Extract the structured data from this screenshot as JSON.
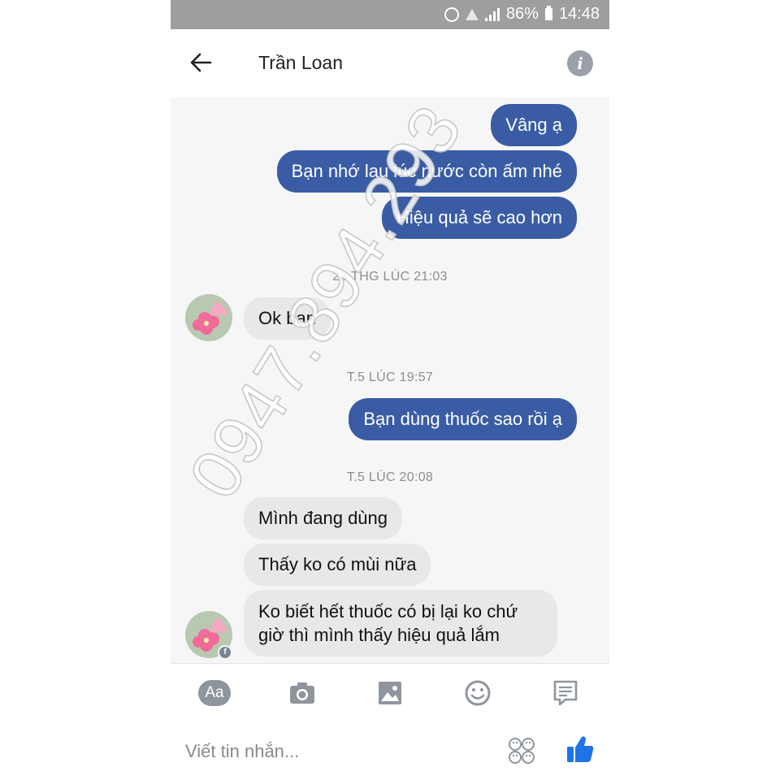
{
  "status_bar": {
    "battery": "86%",
    "time": "14:48"
  },
  "header": {
    "title": "Trần Loan",
    "back_icon": "arrow-left-icon",
    "info_icon": "info-icon"
  },
  "messages": {
    "out1": "Vâng ạ",
    "out2": "Bạn nhớ lau lúc nước còn ấm nhé",
    "out3": "Hiệu quả sẽ cao hơn",
    "ts1": "23 THG LÚC 21:03",
    "in1": "Ok bạn",
    "ts2": "T.5 LÚC 19:57",
    "out4": "Bạn dùng thuốc sao rồi ạ",
    "ts3": "T.5 LÚC 20:08",
    "in2": "Mình đang dùng",
    "in3": "Thấy ko có mùi nữa",
    "in4": "Ko biết hết thuốc có bị lại ko chứ giờ thì mình thấy hiệu quả lắm"
  },
  "watermark": "0947.894.293",
  "toolbar": {
    "aa_label": "Aa",
    "icons": [
      "text-icon",
      "camera-icon",
      "image-icon",
      "emoji-icon",
      "sticker-icon"
    ]
  },
  "composer": {
    "placeholder": "Viết tin nhắn...",
    "icons": [
      "emoji-faces-icon",
      "thumbs-up-icon"
    ]
  },
  "colors": {
    "accent": "#3a5ca5",
    "incoming_bubble": "#e8e8e8",
    "like": "#1f73e6",
    "status_bar": "#9e9e9e"
  }
}
